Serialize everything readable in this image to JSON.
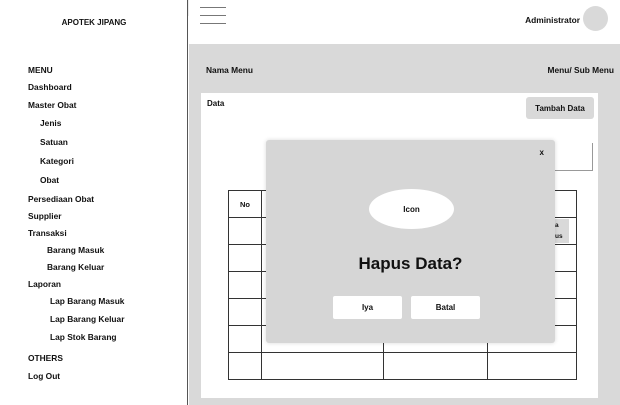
{
  "brand": {
    "title": "APOTEK JIPANG"
  },
  "header": {
    "user_name": "Administrator"
  },
  "sidebar": {
    "items": [
      {
        "label": "MENU"
      },
      {
        "label": "Dashboard"
      },
      {
        "label": "Master Obat"
      },
      {
        "label": "Jenis"
      },
      {
        "label": "Satuan"
      },
      {
        "label": "Kategori"
      },
      {
        "label": "Obat"
      },
      {
        "label": "Persediaan Obat"
      },
      {
        "label": "Supplier"
      },
      {
        "label": "Transaksi"
      },
      {
        "label": "Barang Masuk"
      },
      {
        "label": "Barang Keluar"
      },
      {
        "label": "Laporan"
      },
      {
        "label": "Lap Barang Masuk"
      },
      {
        "label": "Lap Barang Keluar"
      },
      {
        "label": "Lap Stok Barang"
      },
      {
        "label": "OTHERS"
      },
      {
        "label": "Log Out"
      }
    ]
  },
  "breadcrumb": {
    "left": "Nama Menu",
    "right": "Menu/ Sub Menu"
  },
  "card": {
    "title": "Data",
    "add_button": "Tambah Data"
  },
  "table": {
    "header_first": "No",
    "partial_action_label_1": "a",
    "partial_action_label_2": "us"
  },
  "modal": {
    "close": "x",
    "icon_label": "Icon",
    "title": "Hapus Data?",
    "confirm": "Iya",
    "cancel": "Batal"
  }
}
